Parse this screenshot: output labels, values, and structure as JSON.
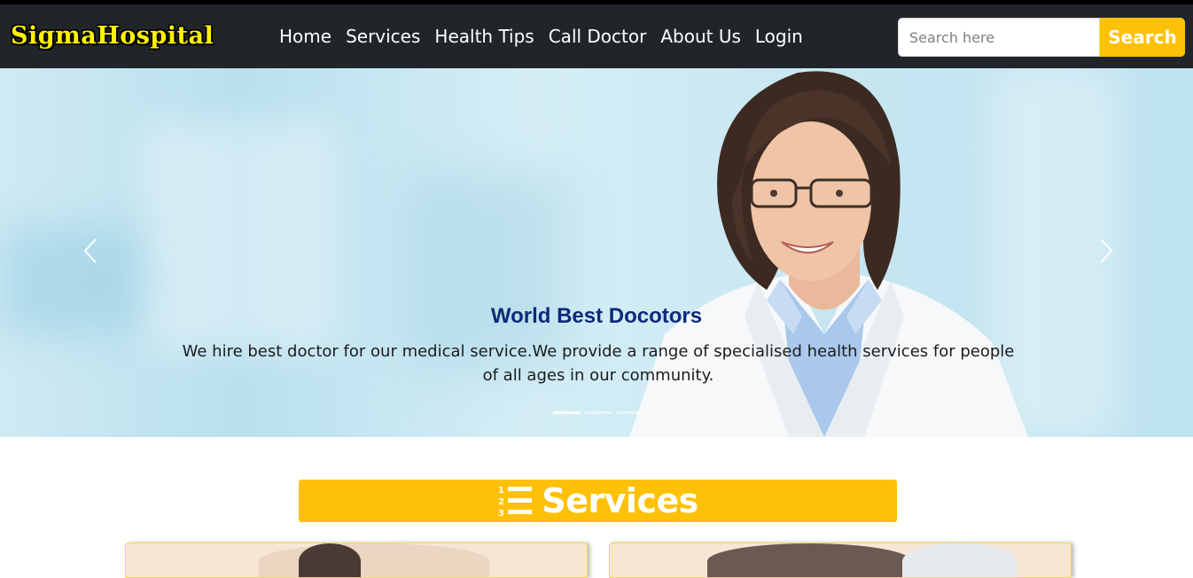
{
  "brand": "SigmaHospital",
  "nav": {
    "items": [
      "Home",
      "Services",
      "Health Tips",
      "Call Doctor",
      "About Us",
      "Login"
    ]
  },
  "search": {
    "placeholder": "Search here",
    "button_label": "Search"
  },
  "carousel": {
    "caption_title": "World Best Docotors",
    "caption_text": "We hire best doctor for our medical service.We provide a range of specialised health services for people of all ages in our community.",
    "slide_count": 3,
    "active_slide": 1
  },
  "services_section": {
    "title": "Services",
    "icon": "list-ol-icon"
  },
  "colors": {
    "navbar": "#212529",
    "accent": "#ffc107",
    "brand_text": "#fff200",
    "caption_title": "#0c2a7a"
  }
}
